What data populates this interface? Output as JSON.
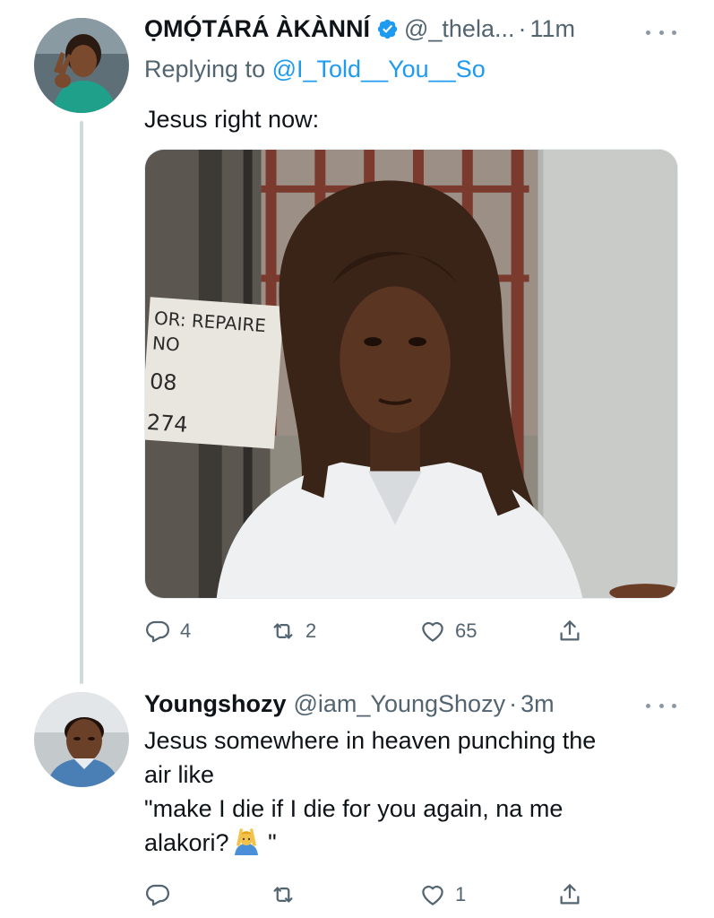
{
  "tweets": [
    {
      "name": "ỌMỌ́TÁRÁ ÀKÀNNÍ",
      "verified": true,
      "handle": "@_thela...",
      "separator": "·",
      "time": "11m",
      "replying_prefix": "Replying to",
      "replying_to": "@I_Told__You__So",
      "text": "Jesus right now:",
      "has_image": true,
      "counts": {
        "replies": "4",
        "retweets": "2",
        "likes": "65"
      }
    },
    {
      "name": "Youngshozy",
      "verified": false,
      "handle": "@iam_YoungShozy",
      "separator": "·",
      "time": "3m",
      "text_lines": [
        "Jesus somewhere in heaven punching the",
        "air like",
        "\"make I die if I die for you again, na me",
        "alakori?"
      ],
      "text_tail": " \"",
      "emoji": "person-gesturing-emoji",
      "counts": {
        "replies": "",
        "retweets": "",
        "likes": "1"
      }
    }
  ],
  "icons": {
    "verified": "verified-badge-icon",
    "more": "more-options-icon",
    "reply": "reply-icon",
    "retweet": "retweet-icon",
    "like": "heart-icon",
    "share": "share-icon"
  },
  "image_sign_text": "OR: REPAIRE NO 08 274",
  "colors": {
    "text": "#0f1419",
    "secondary": "#536471",
    "link": "#1d9bf0",
    "thread_line": "#cfd9de"
  }
}
